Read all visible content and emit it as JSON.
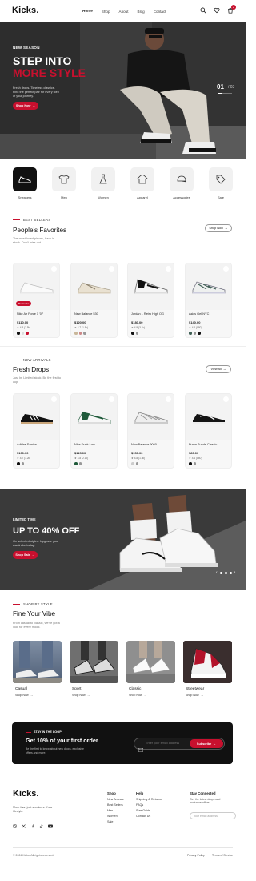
{
  "header": {
    "logo": "Kicks.",
    "nav": [
      "Home",
      "Shop",
      "About",
      "Blog",
      "Contact"
    ],
    "active_nav": "Home",
    "cart_count": "2"
  },
  "hero": {
    "kicker": "NEW SEASON",
    "title_1": "STEP INTO",
    "title_2": "MORE STYLE",
    "subtitle": "Fresh drops. Timeless classics. Find the perfect pair for every step of your journey.",
    "cta": "Shop Now",
    "slide_current": "01",
    "slide_total": "/ 03",
    "colors": {
      "accent": "#c8102e"
    }
  },
  "categories": [
    {
      "label": "Sneakers",
      "icon": "sneaker-icon"
    },
    {
      "label": "Men",
      "icon": "tshirt-icon"
    },
    {
      "label": "Women",
      "icon": "dress-icon"
    },
    {
      "label": "Apparel",
      "icon": "hoodie-icon"
    },
    {
      "label": "Accessories",
      "icon": "cap-icon"
    },
    {
      "label": "Sale",
      "icon": "tag-icon"
    }
  ],
  "best_sellers": {
    "eyebrow": "BEST SELLERS",
    "title": "People's Favorites",
    "subtitle": "The most loved pieces, back in stock. Don't miss out.",
    "button": "Shop Now",
    "items": [
      {
        "name": "Nike Air Force 1 '07",
        "price": "$110.00",
        "rating": "★ 4.8 (2.5k)",
        "badge": "Bestseller"
      },
      {
        "name": "New Balance 530",
        "price": "$120.00",
        "rating": "★ 4.7 (1.8k)"
      },
      {
        "name": "Jordan 1 Retro High OG",
        "price": "$180.00",
        "rating": "★ 4.9 (3.1k)"
      },
      {
        "name": "Asics Gel-NYC",
        "price": "$140.00",
        "rating": "★ 4.6 (980)"
      }
    ]
  },
  "new_arrivals": {
    "eyebrow": "NEW ARRIVALS",
    "title": "Fresh Drops",
    "subtitle": "Just In. Limited stock. Be the first to cop.",
    "button": "View All",
    "items": [
      {
        "name": "Adidas Samba",
        "price": "$100.00",
        "rating": "★ 4.7 (1.2k)"
      },
      {
        "name": "Nike Dunk Low",
        "price": "$115.00",
        "rating": "★ 4.8 (2.1k)"
      },
      {
        "name": "New Balance 9060",
        "price": "$150.00",
        "rating": "★ 4.8 (1.5k)"
      },
      {
        "name": "Puma Suede Classic",
        "price": "$80.00",
        "rating": "★ 4.6 (860)"
      }
    ]
  },
  "promo": {
    "kicker": "LIMITED TIME",
    "title": "UP TO 40% OFF",
    "subtitle": "On selected styles. Upgrade your wardrobe today.",
    "cta": "Shop Sale"
  },
  "vibe": {
    "eyebrow": "SHOP BY STYLE",
    "title": "Fine Your Vibe",
    "subtitle": "From casual to classic, we've got a look for every mood.",
    "items": [
      {
        "title": "Casual",
        "link": "Shop Now"
      },
      {
        "title": "Sport",
        "link": "Shop Now"
      },
      {
        "title": "Classic",
        "link": "Shop Now"
      },
      {
        "title": "Streetwear",
        "link": "Shop Now"
      }
    ]
  },
  "newsletter": {
    "kicker": "STAY IN THE LOOP",
    "title": "Get 10% of your first order",
    "subtitle": "Be the first to know about new drops, exclusive offers and more.",
    "placeholder": "Enter your email address",
    "button": "Subscribe"
  },
  "footer": {
    "logo": "Kicks.",
    "tagline": "More than just sneakers. It's a lifestyle.",
    "shop": {
      "heading": "Shop",
      "links": [
        "New Arrivals",
        "Best Sellers",
        "Men",
        "Women",
        "Sale"
      ]
    },
    "help": {
      "heading": "Help",
      "links": [
        "Shipping & Returns",
        "FAQs",
        "Size Guide",
        "Contact Us"
      ]
    },
    "stay": {
      "heading": "Stay Connected",
      "text": "Get the latest drops and exclusive offers.",
      "placeholder": "Your email address"
    },
    "copyright": "© 2024 Kicks. All rights reserved.",
    "privacy": "Privacy Policy",
    "terms": "Terms of Service"
  }
}
